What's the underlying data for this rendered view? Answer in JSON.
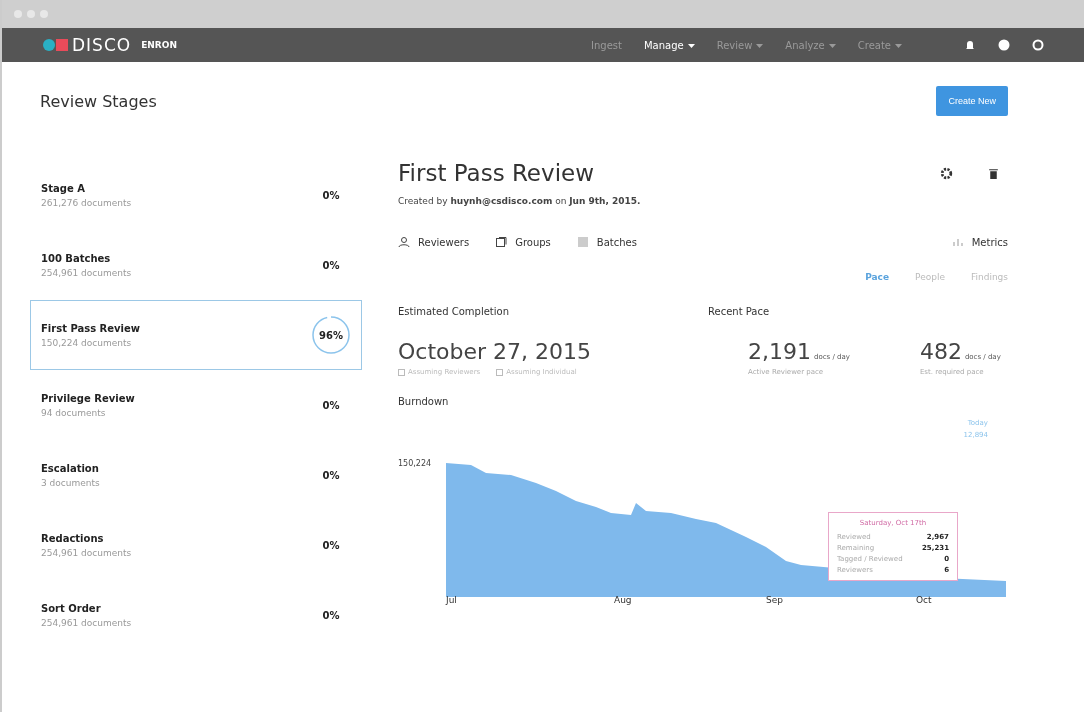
{
  "brand": {
    "name": "DISCO",
    "workspace": "ENRON"
  },
  "nav": [
    {
      "label": "Ingest",
      "dropdown": false,
      "active": false
    },
    {
      "label": "Manage",
      "dropdown": true,
      "active": true
    },
    {
      "label": "Review",
      "dropdown": true,
      "active": false
    },
    {
      "label": "Analyze",
      "dropdown": true,
      "active": false
    },
    {
      "label": "Create",
      "dropdown": true,
      "active": false
    }
  ],
  "page_title": "Review Stages",
  "create_button": "Create New",
  "stages": [
    {
      "name": "Stage A",
      "count": "261,276 documents",
      "percent": "0%",
      "selected": false
    },
    {
      "name": "100 Batches",
      "count": "254,961 documents",
      "percent": "0%",
      "selected": false
    },
    {
      "name": "First Pass Review",
      "count": "150,224 documents",
      "percent": "96%",
      "selected": true,
      "level": 0.96
    },
    {
      "name": "Privilege Review",
      "count": "94 documents",
      "percent": "0%",
      "selected": false
    },
    {
      "name": "Escalation",
      "count": "3 documents",
      "percent": "0%",
      "selected": false
    },
    {
      "name": "Redactions",
      "count": "254,961 documents",
      "percent": "0%",
      "selected": false
    },
    {
      "name": "Sort Order",
      "count": "254,961 documents",
      "percent": "0%",
      "selected": false
    }
  ],
  "detail": {
    "title": "First Pass Review",
    "created": "Created by **huynh@csdisco.com** on **Jun 9th, 2015.**",
    "links": [
      {
        "kind": "person",
        "label": "Reviewers"
      },
      {
        "kind": "groups",
        "label": "Groups"
      },
      {
        "kind": "grid",
        "label": "Batches"
      }
    ],
    "metrics_link": "Metrics",
    "tabs": [
      {
        "label": "Pace",
        "selected": true
      },
      {
        "label": "People",
        "selected": false
      },
      {
        "label": "Findings",
        "selected": false
      }
    ],
    "completion": {
      "heading": "Estimated Completion",
      "date": "October 27, 2015",
      "options": [
        {
          "label": "Assuming Reviewers",
          "checked": false
        },
        {
          "label": "Assuming Individual",
          "checked": false
        }
      ]
    },
    "pace": {
      "heading": "Recent Pace",
      "stats": [
        {
          "value": "2,191",
          "unit": "docs / day",
          "caption": "Active Reviewer pace"
        },
        {
          "value": "482",
          "unit": "docs / day",
          "caption": "Est. required pace"
        }
      ]
    },
    "burndown": {
      "heading": "Burndown",
      "y_label": "150,224",
      "x_labels": [
        "Jul",
        "Aug",
        "Sep",
        "Oct"
      ],
      "today": {
        "label": "Today",
        "value": "12,894"
      },
      "tooltip": {
        "title": "Saturday, Oct 17th",
        "rows": [
          {
            "label": "Reviewed",
            "value": "2,967"
          },
          {
            "label": "Remaining",
            "value": "25,231"
          },
          {
            "label": "Tagged / Reviewed",
            "value": "0"
          },
          {
            "label": "Reviewers",
            "value": "6"
          }
        ]
      }
    }
  }
}
